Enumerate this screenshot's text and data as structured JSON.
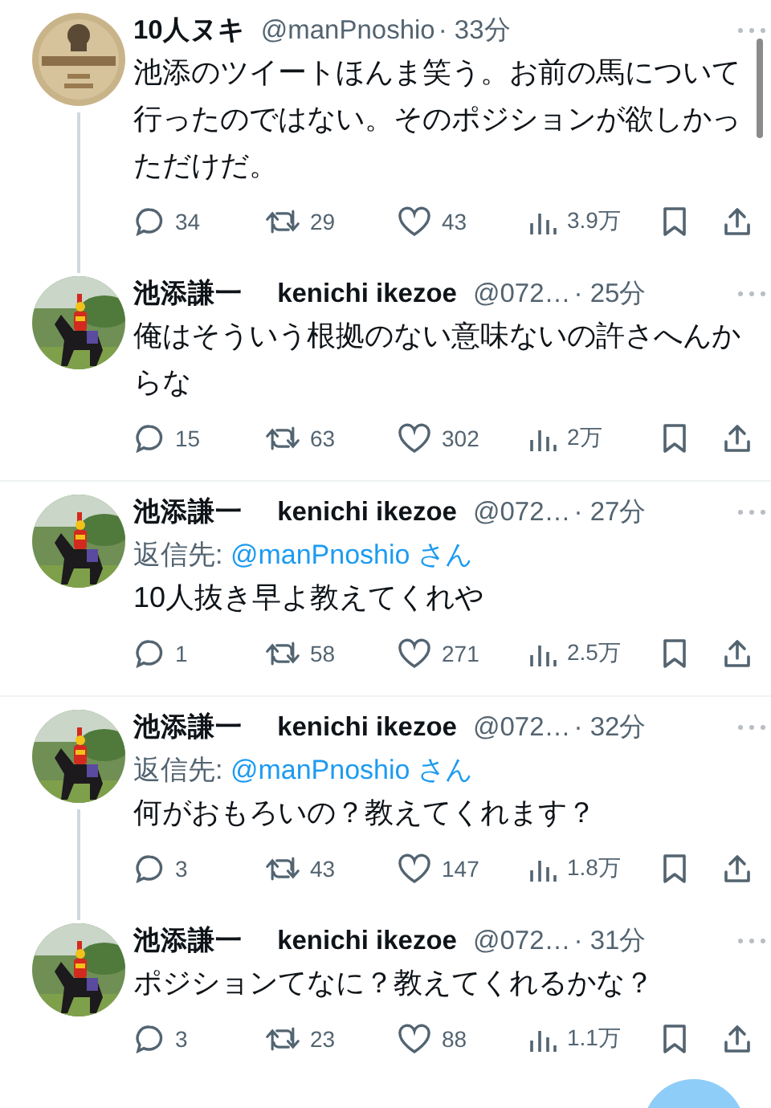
{
  "tweets": [
    {
      "name": "10人ヌキ",
      "handle": "@manPnoshio",
      "time": "· 33分",
      "text": "池添のツイートほんま笑う。お前の馬について行ったのではない。そのポジションが欲しかっただけだ。",
      "thread_below": true,
      "stats": {
        "replies": "34",
        "reposts": "29",
        "likes": "43",
        "views": "3.9万"
      }
    },
    {
      "name": "池添謙一　 kenichi ikezoe",
      "handle": "@072…",
      "time": "· 25分",
      "text": "俺はそういう根拠のない意味ないの許さへんからな",
      "thread_below": false,
      "stats": {
        "replies": "15",
        "reposts": "63",
        "likes": "302",
        "views": "2万"
      }
    },
    {
      "name": "池添謙一　 kenichi ikezoe",
      "handle": "@072…",
      "time": "· 27分",
      "reply_to": {
        "prefix": "返信先:",
        "mention": "@manPnoshio さん"
      },
      "text": "10人抜き早よ教えてくれや",
      "thread_below": false,
      "stats": {
        "replies": "1",
        "reposts": "58",
        "likes": "271",
        "views": "2.5万"
      }
    },
    {
      "name": "池添謙一　 kenichi ikezoe",
      "handle": "@072…",
      "time": "· 32分",
      "reply_to": {
        "prefix": "返信先:",
        "mention": "@manPnoshio さん"
      },
      "text": "何がおもろいの？教えてくれます？",
      "thread_below": true,
      "stats": {
        "replies": "3",
        "reposts": "43",
        "likes": "147",
        "views": "1.8万"
      }
    },
    {
      "name": "池添謙一　 kenichi ikezoe",
      "handle": "@072…",
      "time": "· 31分",
      "text": "ポジションてなに？教えてくれるかな？",
      "thread_below": false,
      "stats": {
        "replies": "3",
        "reposts": "23",
        "likes": "88",
        "views": "1.1万"
      }
    }
  ]
}
